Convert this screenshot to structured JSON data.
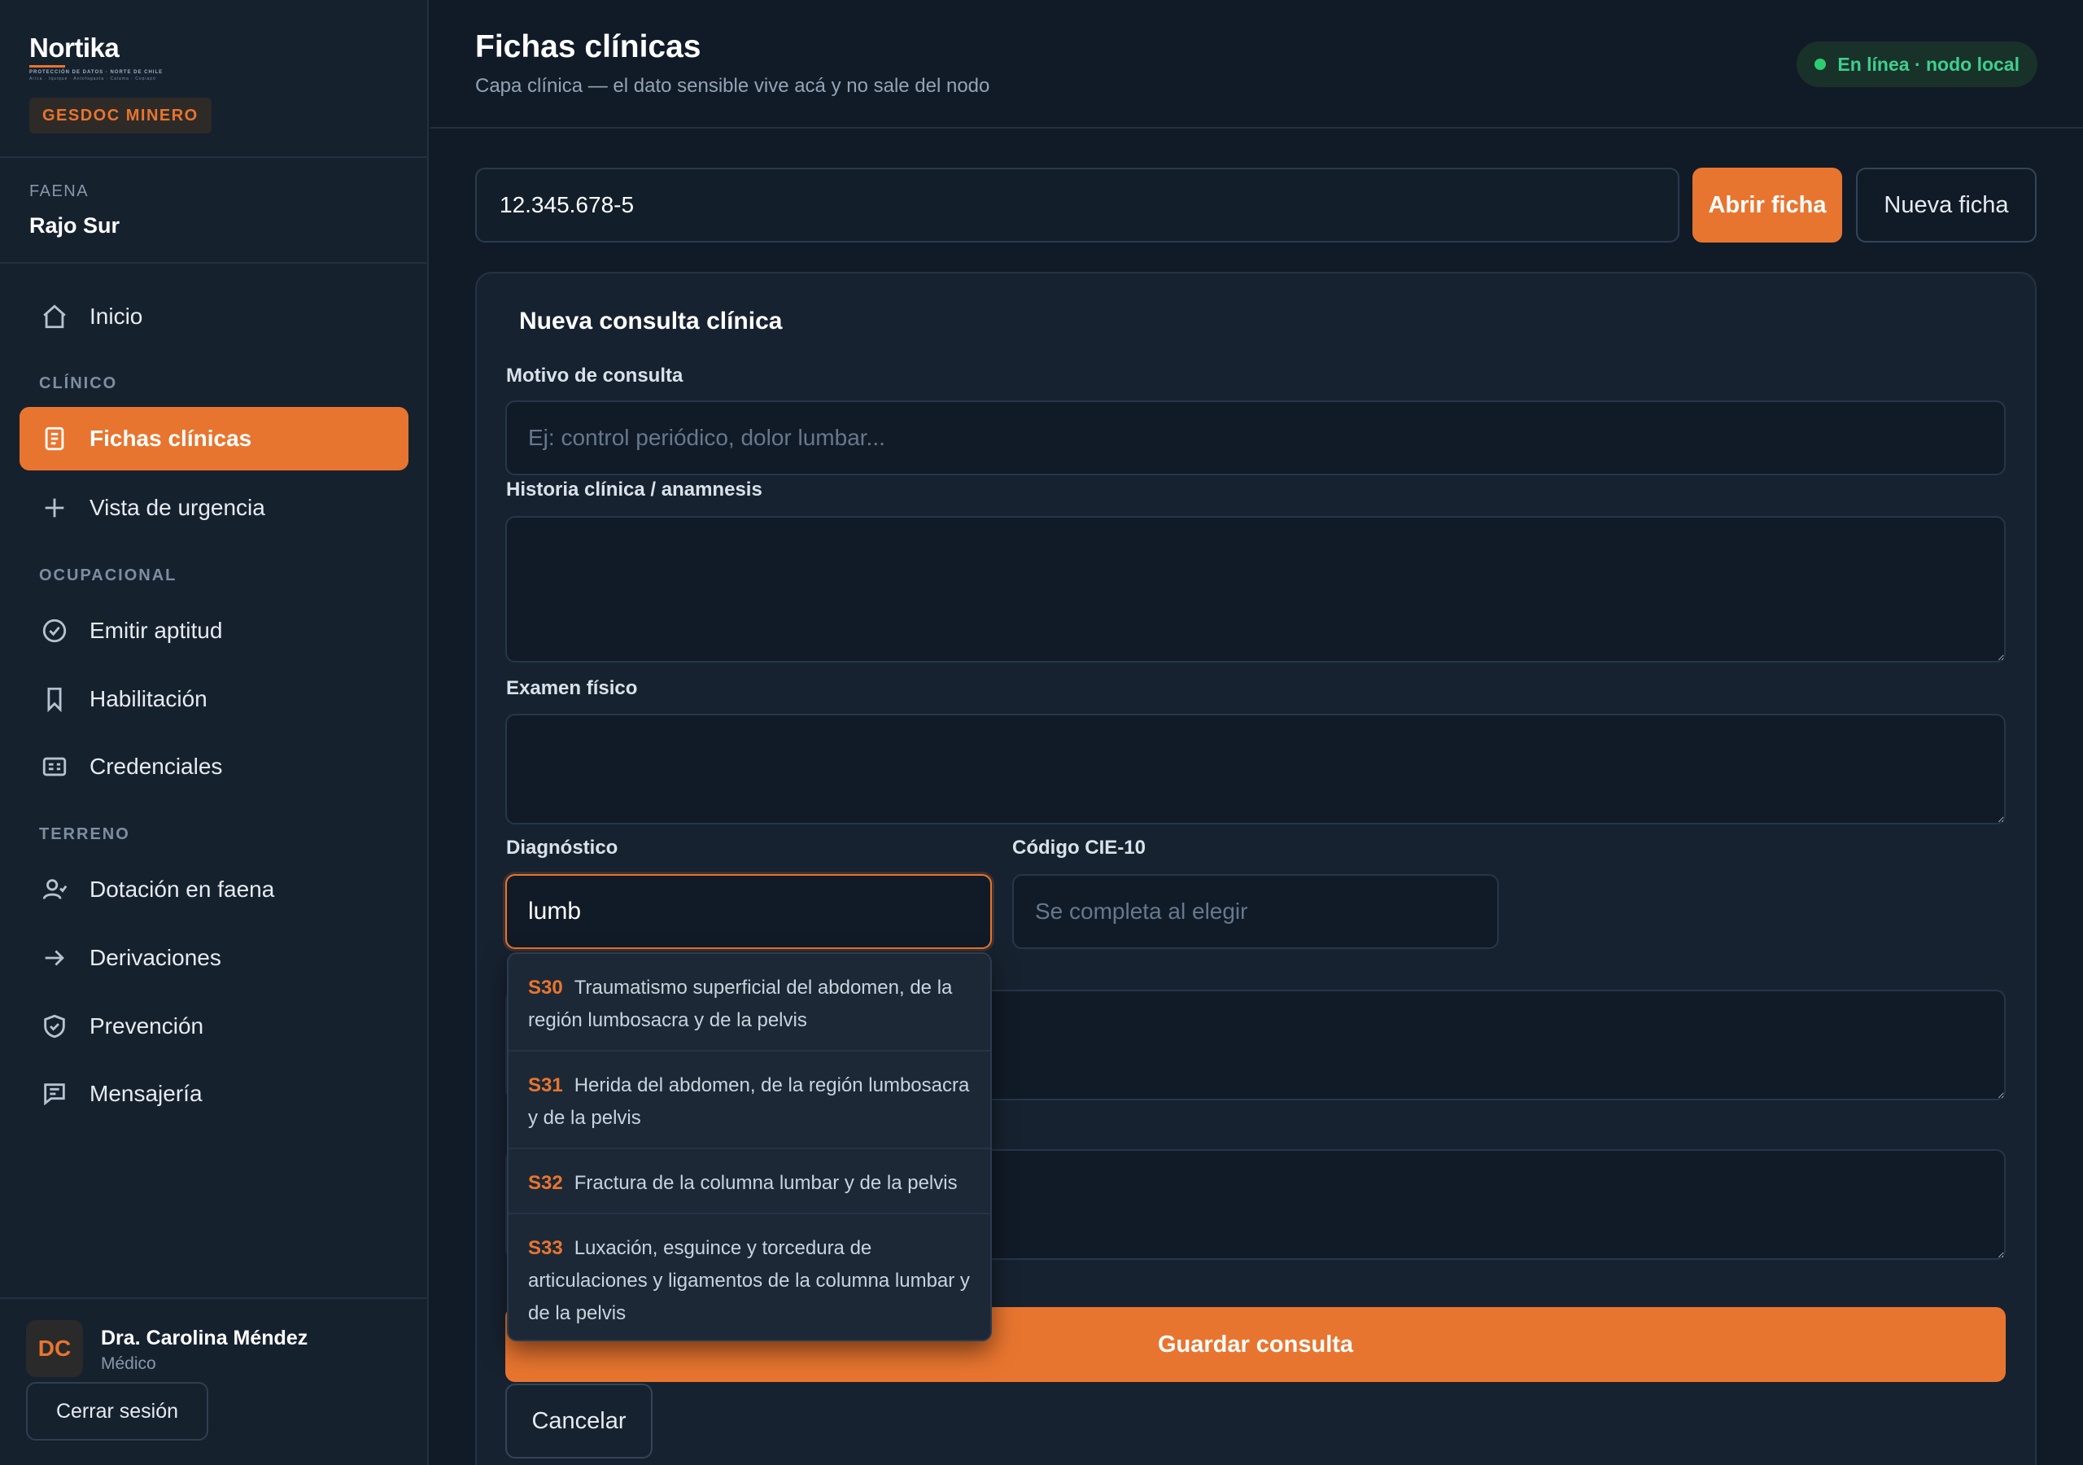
{
  "brand": {
    "name": "Nortika",
    "tagline": "PROTECCIÓN DE DATOS · NORTE DE CHILE",
    "regions": "Arica · Iquique · Antofagasta · Calama · Copiapó",
    "badge": "GESDOC MINERO"
  },
  "faena": {
    "label": "FAENA",
    "value": "Rajo Sur"
  },
  "nav": {
    "inicio": "Inicio",
    "section_clinico": "CLÍNICO",
    "fichas": "Fichas clínicas",
    "urgencia": "Vista de urgencia",
    "section_ocupacional": "OCUPACIONAL",
    "aptitud": "Emitir aptitud",
    "habilitacion": "Habilitación",
    "credenciales": "Credenciales",
    "section_terreno": "TERRENO",
    "dotacion": "Dotación en faena",
    "derivaciones": "Derivaciones",
    "prevencion": "Prevención",
    "mensajeria": "Mensajería"
  },
  "user": {
    "initials": "DC",
    "name": "Dra. Carolina Méndez",
    "role": "Médico",
    "logout": "Cerrar sesión"
  },
  "header": {
    "title": "Fichas clínicas",
    "subtitle": "Capa clínica — el dato sensible vive acá y no sale del nodo",
    "status": "En línea · nodo local",
    "status_color": "#2ecc71"
  },
  "search": {
    "rut_value": "12.345.678-5",
    "open_label": "Abrir ficha",
    "new_label": "Nueva ficha"
  },
  "form": {
    "title": "Nueva consulta clínica",
    "motivo_label": "Motivo de consulta",
    "motivo_placeholder": "Ej: control periódico, dolor lumbar...",
    "historia_label": "Historia clínica / anamnesis",
    "examen_label": "Examen físico",
    "diagnostico_label": "Diagnóstico",
    "diagnostico_value": "lumb",
    "cie_label": "Código CIE-10",
    "cie_placeholder": "Se completa al elegir",
    "save_label": "Guardar consulta",
    "cancel_label": "Cancelar"
  },
  "suggestions": [
    {
      "code": "S30",
      "text": "Traumatismo superficial del abdomen, de la región lumbosacra y de la pelvis"
    },
    {
      "code": "S31",
      "text": "Herida del abdomen, de la región lumbosacra y de la pelvis"
    },
    {
      "code": "S32",
      "text": "Fractura de la columna lumbar y de la pelvis"
    },
    {
      "code": "S33",
      "text": "Luxación, esguince y torcedura de articulaciones y ligamentos de la columna lumbar y de la pelvis"
    }
  ],
  "colors": {
    "accent": "#e8752f",
    "background": "#111b27",
    "sidebar": "#16212e"
  }
}
